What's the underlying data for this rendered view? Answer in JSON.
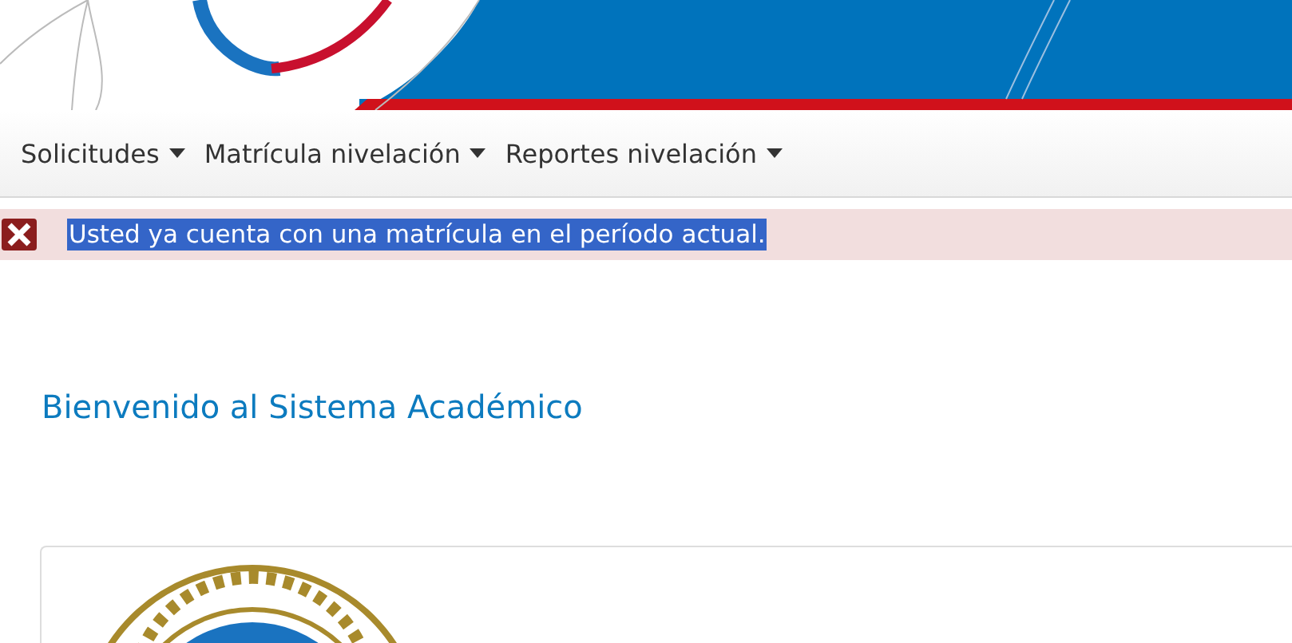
{
  "nav": {
    "menus": [
      {
        "label": "Solicitudes"
      },
      {
        "label": "Matrícula nivelación"
      },
      {
        "label": "Reportes nivelación"
      }
    ]
  },
  "alert": {
    "kind": "error",
    "message": "Usted ya cuenta con una matrícula en el período actual.",
    "highlighted": true
  },
  "welcome": {
    "title": "Bienvenido al Sistema Académico"
  }
}
